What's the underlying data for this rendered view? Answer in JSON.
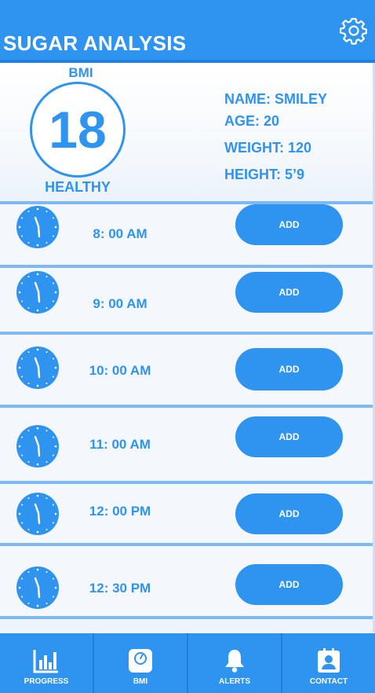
{
  "header": {
    "title": "SUGAR ANALYSIS",
    "settings_icon": "gear-icon"
  },
  "summary": {
    "bmi_label": "BMI",
    "bmi_value": "18",
    "bmi_status": "HEALTHY",
    "name": "NAME: SMILEY",
    "age": "AGE: 20",
    "weight": "WEIGHT: 120",
    "height": "HEIGHT: 5’9"
  },
  "schedule": [
    {
      "time": "8: 00 AM",
      "button": "ADD"
    },
    {
      "time": "9: 00 AM",
      "button": "ADD"
    },
    {
      "time": "10: 00 AM",
      "button": "ADD"
    },
    {
      "time": "11: 00 AM",
      "button": "ADD"
    },
    {
      "time": "12: 00 PM",
      "button": "ADD"
    },
    {
      "time": "12: 30 PM",
      "button": "ADD"
    }
  ],
  "nav": {
    "progress": "PROGRESS",
    "bmi": "BMI",
    "alerts": "ALERTS",
    "contact": "CONTACT"
  },
  "colors": {
    "primary": "#2f93f0",
    "primary_dark": "#1e7fe0",
    "row_bg": "#f4f8fc"
  }
}
